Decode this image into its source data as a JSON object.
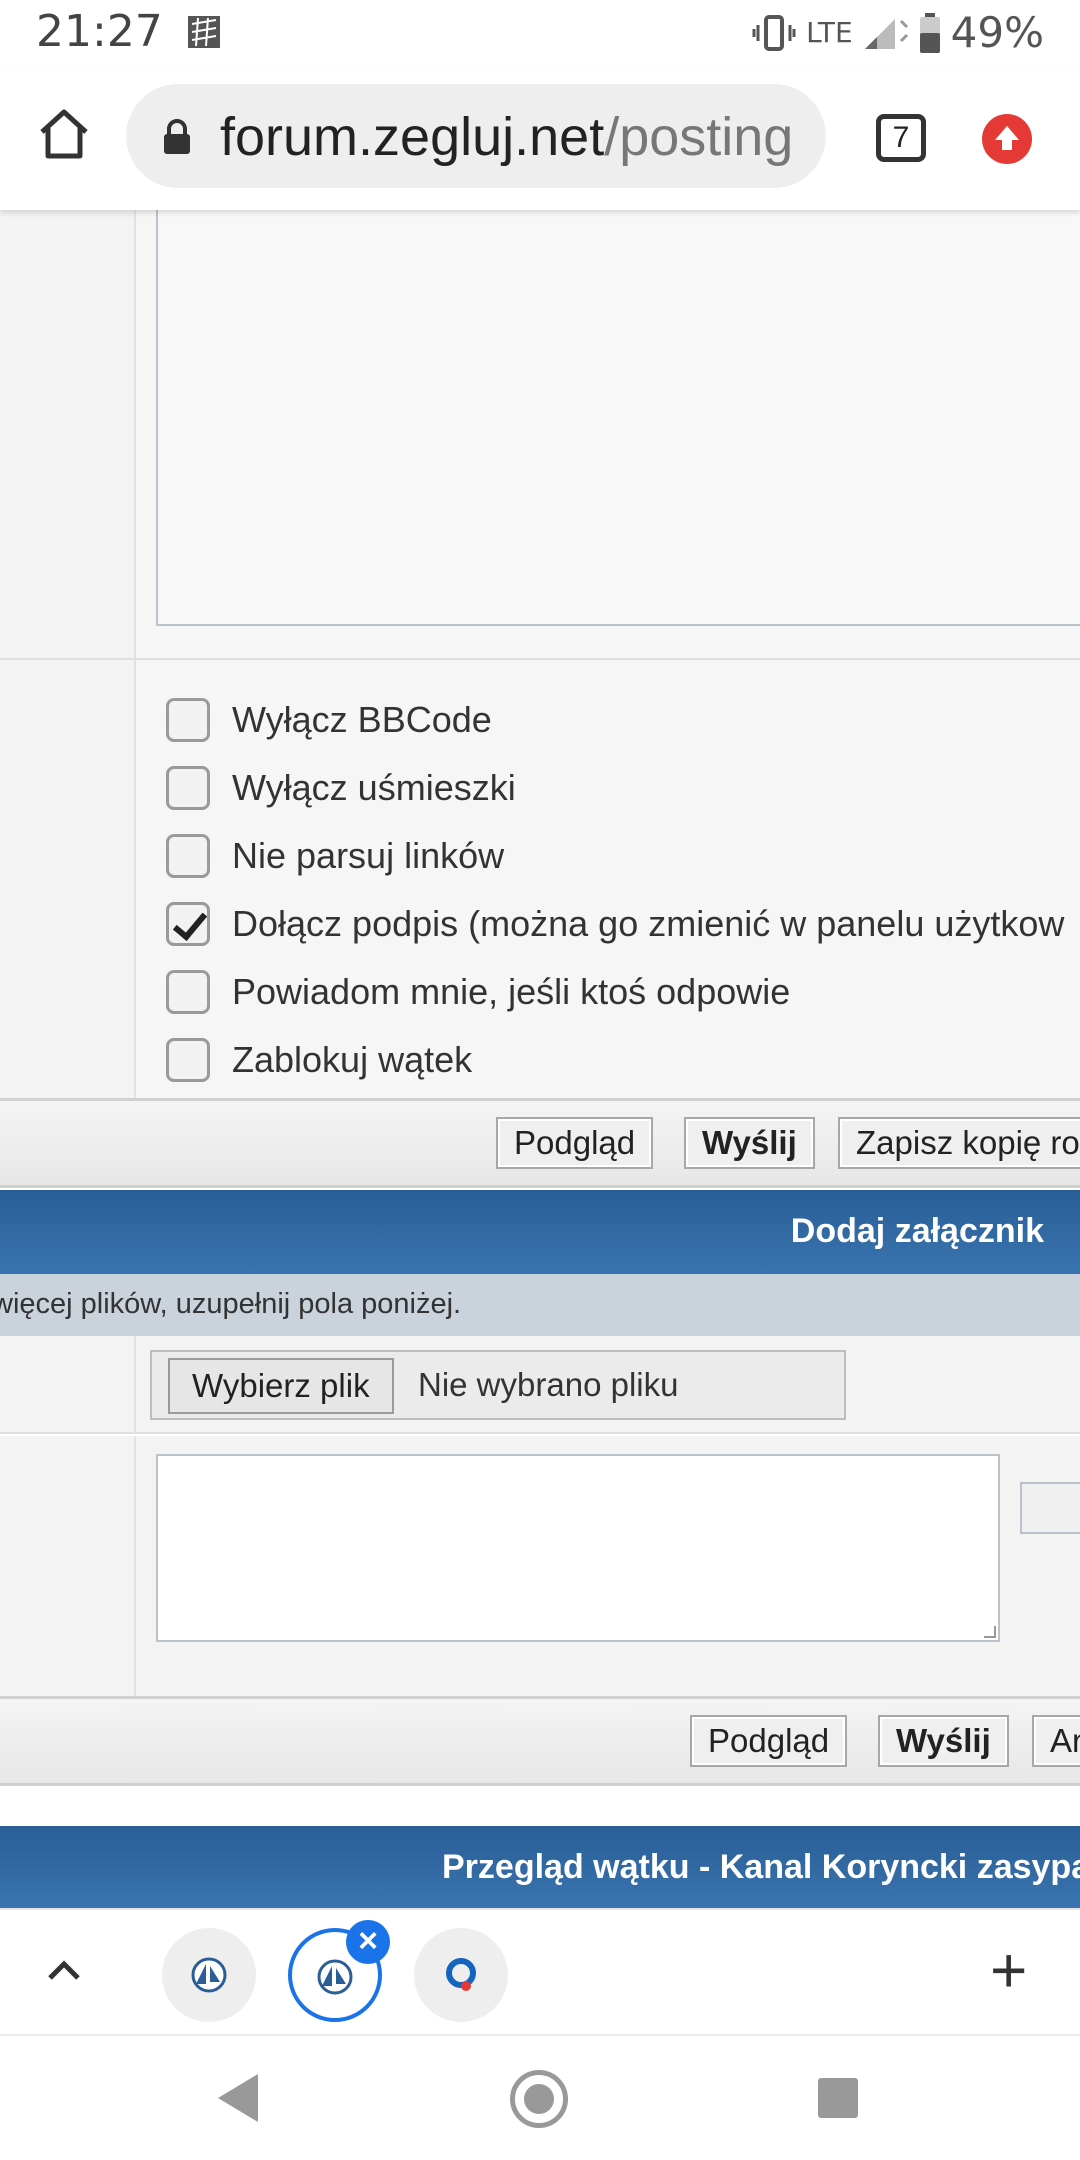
{
  "status_bar": {
    "time": "21:27",
    "network": "LTE",
    "battery": "49%",
    "icons": [
      "notification-icon",
      "vibrate-icon",
      "signal-icon",
      "battery-icon"
    ]
  },
  "browser": {
    "url_host": "forum.zegluj.net",
    "url_path": "/posting",
    "tab_count": "7",
    "icons": [
      "home-icon",
      "lock-icon",
      "tabs-icon",
      "update-icon"
    ]
  },
  "options": [
    {
      "label": "Wyłącz BBCode",
      "checked": false
    },
    {
      "label": "Wyłącz uśmieszki",
      "checked": false
    },
    {
      "label": "Nie parsuj linków",
      "checked": false
    },
    {
      "label": "Dołącz podpis (można go zmienić w panelu użytkow",
      "checked": true
    },
    {
      "label": "Powiadom mnie, jeśli ktoś odpowie",
      "checked": false
    },
    {
      "label": "Zablokuj wątek",
      "checked": false
    }
  ],
  "buttons_top": {
    "preview": "Podgląd",
    "submit": "Wyślij",
    "save_draft": "Zapisz kopię ro"
  },
  "attachment": {
    "header": "Dodaj załącznik",
    "info": "więcej plików, uzupełnij pola poniżej.",
    "choose_file": "Wybierz plik",
    "file_status": "Nie wybrano pliku"
  },
  "buttons_bottom": {
    "preview": "Podgląd",
    "submit": "Wyślij",
    "cancel_partial": "An"
  },
  "thread_review": {
    "header": "Przegląd wątku - Kanal Koryncki zasypan"
  },
  "colors": {
    "header_blue": "#2a5e96",
    "accent_blue": "#1a73e8",
    "update_red": "#e53935"
  }
}
